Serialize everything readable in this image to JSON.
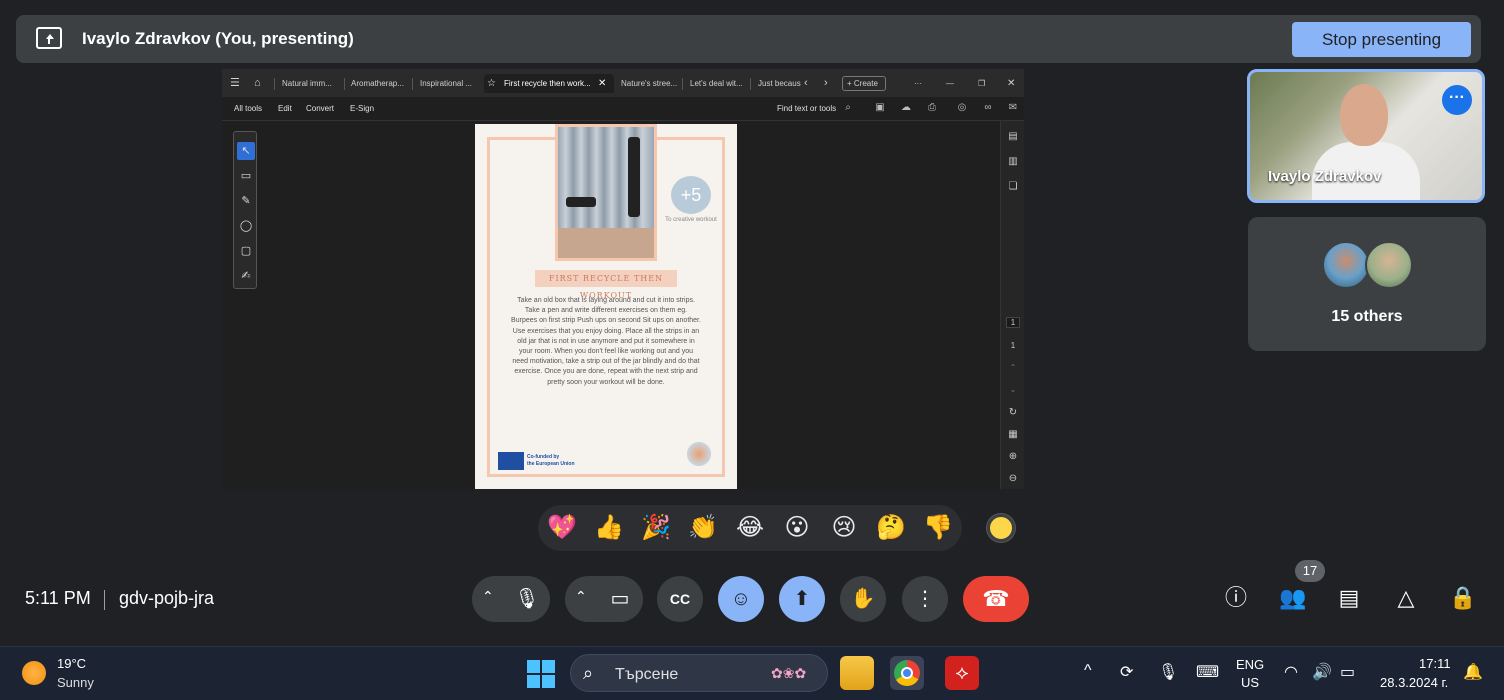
{
  "presenting_bar": {
    "title": "Ivaylo Zdravkov (You, presenting)",
    "stop_label": "Stop presenting"
  },
  "shared_screen": {
    "tabs": [
      "Natural imm...",
      "Aromatherap...",
      "Inspirational ...",
      "First recycle then work...",
      "Nature's stree...",
      "Let's deal wit...",
      "Just becaus"
    ],
    "create_label": "Create",
    "menu": [
      "All tools",
      "Edit",
      "Convert",
      "E-Sign"
    ],
    "find_text": "Find text or tools",
    "page_current": "1",
    "page_total": "1",
    "document": {
      "badge": "+5",
      "badge_caption": "To creative workout",
      "heading": "FIRST RECYCLE THEN WORKOUT",
      "body": "Take an old box that is laying around and cut it into strips. Take a pen and write different exercises on them eg. Burpees on first strip Push ups on second Sit ups on another. Use exercises that you enjoy doing. Place all the strips in an old jar that is not in use anymore and put it somewhere in your room. When you don't feel like working out and you need motivation, take a strip out of the jar blindly and do that exercise. Once you are done, repeat with the next strip and pretty soon your workout will be done.",
      "eu_line1": "Co-funded by",
      "eu_line2": "the European Union",
      "signature": "Oleen"
    }
  },
  "self_tile": {
    "name": "Ivaylo Zdravkov"
  },
  "others_tile": {
    "label": "15 others"
  },
  "reactions": [
    "💖",
    "👍",
    "🎉",
    "👏",
    "😂",
    "😮",
    "😢",
    "🤔",
    "👎"
  ],
  "meeting": {
    "time": "5:11 PM",
    "code": "gdv-pojb-jra",
    "participant_count": "17"
  },
  "taskbar": {
    "temperature": "19°C",
    "condition": "Sunny",
    "search_placeholder": "Търсене",
    "lang_line1": "ENG",
    "lang_line2": "US",
    "clock": "17:11",
    "date": "28.3.2024 г."
  },
  "colors": {
    "accent": "#8ab4f8",
    "end_call": "#ea4335",
    "bar": "#3c4043",
    "background": "#202124"
  }
}
